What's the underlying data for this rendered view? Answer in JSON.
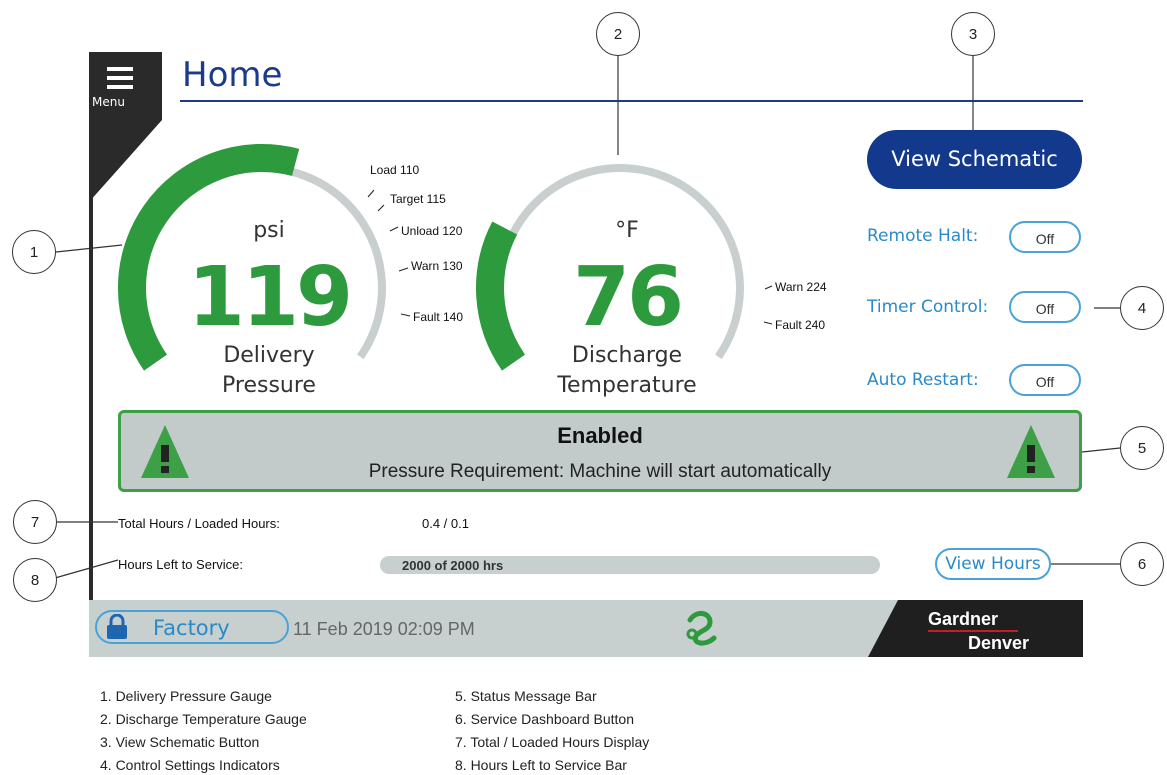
{
  "header": {
    "menu_label": "Menu",
    "title": "Home"
  },
  "gauges": {
    "pressure": {
      "unit": "psi",
      "value": "119",
      "label_line1": "Delivery",
      "label_line2": "Pressure",
      "fill_fraction": 0.56,
      "ticks": [
        "Load 110",
        "Target 115",
        "Unload 120",
        "Warn 130",
        "Fault 140"
      ]
    },
    "temperature": {
      "unit": "°F",
      "value": "76",
      "label_line1": "Discharge",
      "label_line2": "Temperature",
      "fill_fraction": 0.25,
      "ticks": [
        "Warn 224",
        "Fault 240"
      ]
    }
  },
  "controls": {
    "view_schematic": "View Schematic",
    "items": [
      {
        "label": "Remote Halt:",
        "state": "Off"
      },
      {
        "label": "Timer Control:",
        "state": "Off"
      },
      {
        "label": "Auto Restart:",
        "state": "Off"
      }
    ]
  },
  "status": {
    "title": "Enabled",
    "message": "Pressure Requirement: Machine will start automatically"
  },
  "hours": {
    "total_label": "Total Hours / Loaded Hours:",
    "total_value": "0.4  / 0.1",
    "service_label": "Hours Left to Service:",
    "service_value": "2000 of 2000 hrs",
    "view_hours": "View Hours"
  },
  "footer": {
    "access_level": "Factory",
    "datetime": "11 Feb 2019  02:09 PM",
    "brand_line1": "Gardner",
    "brand_line2": "Denver"
  },
  "callouts": [
    "1",
    "2",
    "3",
    "4",
    "5",
    "6",
    "7",
    "8"
  ],
  "legend": {
    "left": [
      "1. Delivery Pressure Gauge",
      "2. Discharge Temperature Gauge",
      "3. View Schematic Button",
      "4. Control Settings Indicators"
    ],
    "right": [
      "5. Status Message Bar",
      "6. Service Dashboard Button",
      "7. Total / Loaded Hours Display",
      "8. Hours Left to Service Bar"
    ]
  },
  "colors": {
    "accent_blue": "#12398c",
    "ok_green": "#2e9a3e",
    "link_blue": "#2a8ac8",
    "panel_gray": "#c8cfcf"
  }
}
